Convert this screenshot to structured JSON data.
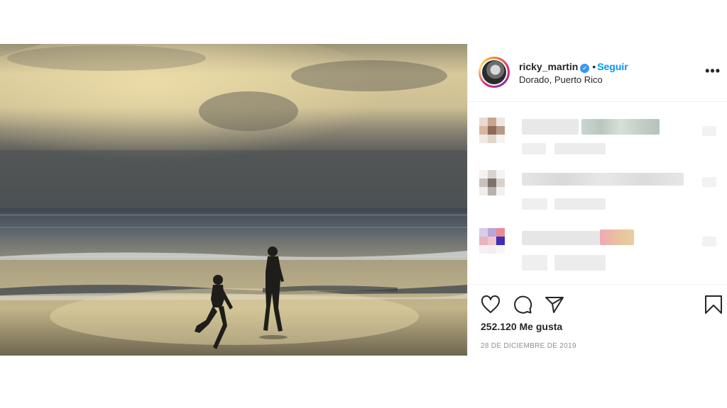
{
  "post": {
    "photo_alt": "beach-sunset-photo",
    "user": {
      "username": "ricky_martin",
      "verified_icon": "✓",
      "separator": "•",
      "follow_label": "Seguir",
      "location": "Dorado, Puerto Rico",
      "more_label": "•••"
    },
    "likes": "252.120 Me gusta",
    "date": "28 DE DICIEMBRE DE 2019"
  },
  "colors": {
    "accent": "#0095f6",
    "verified": "#3897f0",
    "muted": "#8e8e8e",
    "border": "#efefef"
  },
  "icons": [
    "heart-icon",
    "comment-icon",
    "share-icon",
    "bookmark-icon",
    "more-options-icon",
    "verified-icon"
  ]
}
